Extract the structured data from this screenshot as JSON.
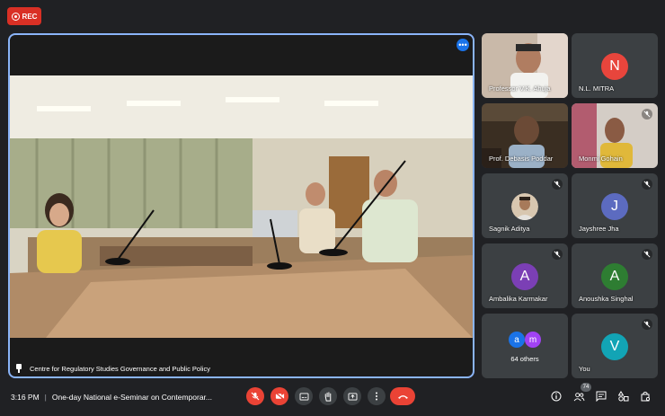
{
  "recording": {
    "label": "REC"
  },
  "main": {
    "caption": "Centre for Regulatory Studies Governance and Public Policy"
  },
  "participants": [
    {
      "name": "Professor V.K. Ahuja",
      "type": "video"
    },
    {
      "name": "N.L. MITRA",
      "type": "avatar",
      "initial": "N",
      "color": "#e8453c"
    },
    {
      "name": "Prof. Debasis Poddar",
      "type": "video"
    },
    {
      "name": "Monmi Gohain",
      "type": "video"
    },
    {
      "name": "Sagnik Aditya",
      "type": "photo"
    },
    {
      "name": "Jayshree Jha",
      "type": "avatar",
      "initial": "J",
      "color": "#5c6bc0"
    },
    {
      "name": "Ambalika Karmakar",
      "type": "avatar",
      "initial": "A",
      "color": "#7b3fb5"
    },
    {
      "name": "Anoushka Singhal",
      "type": "avatar",
      "initial": "A",
      "color": "#2e7d32"
    },
    {
      "name": "64 others",
      "type": "group",
      "initials": [
        "a",
        "m"
      ],
      "colors": [
        "#1a73e8",
        "#a142f4"
      ]
    },
    {
      "name": "You",
      "type": "avatar",
      "initial": "V",
      "color": "#12a4b5"
    }
  ],
  "bottom_bar": {
    "time": "3:16 PM",
    "separator": "|",
    "meeting_title": "One-day National e-Seminar on Contemporar...",
    "people_count": "74"
  },
  "icons": {
    "mic": "mic-off-icon",
    "camera": "camera-off-icon",
    "captions": "captions-icon",
    "hand": "raise-hand-icon",
    "present": "present-icon",
    "more": "more-vert-icon",
    "hangup": "hang-up-icon",
    "info": "info-icon",
    "people": "people-icon",
    "chat": "chat-icon",
    "activities": "activities-icon",
    "host": "host-controls-icon"
  }
}
